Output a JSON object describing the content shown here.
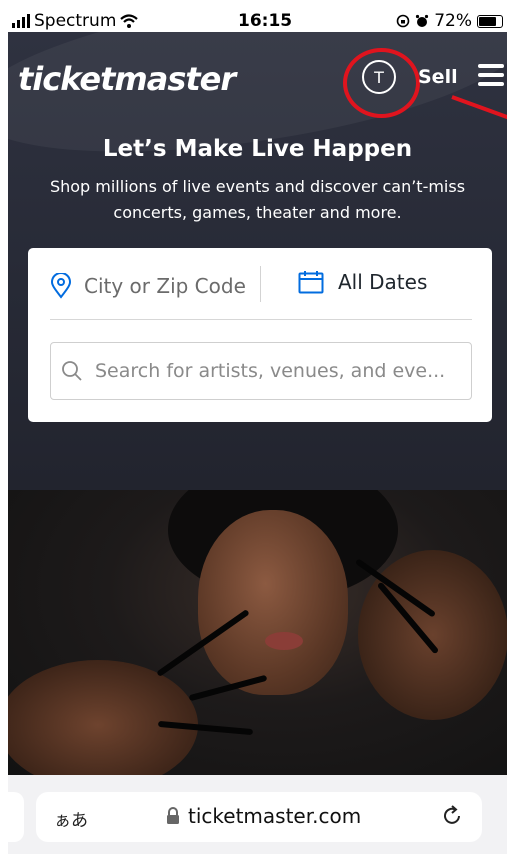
{
  "status": {
    "carrier": "Spectrum",
    "time": "16:15",
    "battery": "72%",
    "battery_level": 0.72
  },
  "header": {
    "logo": "ticketmaster",
    "account_initial": "T",
    "sell_label": "Sell"
  },
  "hero": {
    "headline": "Let’s Make Live Happen",
    "subheadline": "Shop millions of live events and discover can’t-miss concerts, games, theater and more."
  },
  "search": {
    "location_placeholder": "City or Zip Code",
    "date_label": "All Dates",
    "query_placeholder": "Search for artists, venues, and eve..."
  },
  "browser": {
    "aa_label": "ぁあ",
    "url": "ticketmaster.com"
  },
  "colors": {
    "annotation": "#e0141e",
    "hero_bg": "#2b2e3a",
    "accent": "#026cdf"
  },
  "icons": [
    "signal-icon",
    "wifi-icon",
    "orientation-lock-icon",
    "alarm-icon",
    "battery-icon",
    "user-icon",
    "menu-icon",
    "location-pin-icon",
    "calendar-icon",
    "search-icon",
    "lock-icon",
    "reload-icon"
  ]
}
